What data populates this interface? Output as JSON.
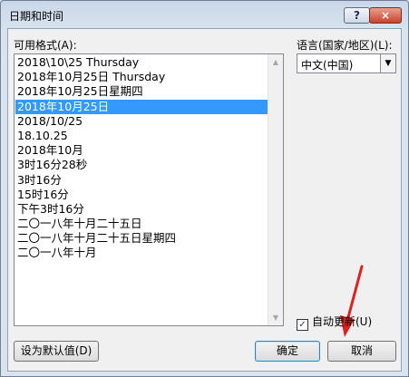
{
  "window": {
    "title": "日期和时间",
    "help_label": "?",
    "close_label": "×"
  },
  "formats": {
    "label": "可用格式(A):",
    "items": [
      "2018\\10\\25 Thursday",
      "2018年10月25日 Thursday",
      "2018年10月25日星期四",
      "2018年10月25日",
      "2018/10/25",
      "18.10.25",
      "2018年10月",
      "3时16分28秒",
      "3时16分",
      "15时16分",
      "下午3时16分",
      "二〇一八年十月二十五日",
      "二〇一八年十月二十五日星期四",
      "二〇一八年十月"
    ],
    "selected_index": 3
  },
  "language": {
    "label": "语言(国家/地区)(L):",
    "value": "中文(中国)"
  },
  "auto_update": {
    "label": "自动更新(U)",
    "checked": true
  },
  "buttons": {
    "set_default": "设为默认值(D)",
    "ok": "确定",
    "cancel": "取消"
  },
  "annotation": {
    "arrow_color": "#e02020"
  },
  "colors": {
    "selection": "#3399ff"
  }
}
